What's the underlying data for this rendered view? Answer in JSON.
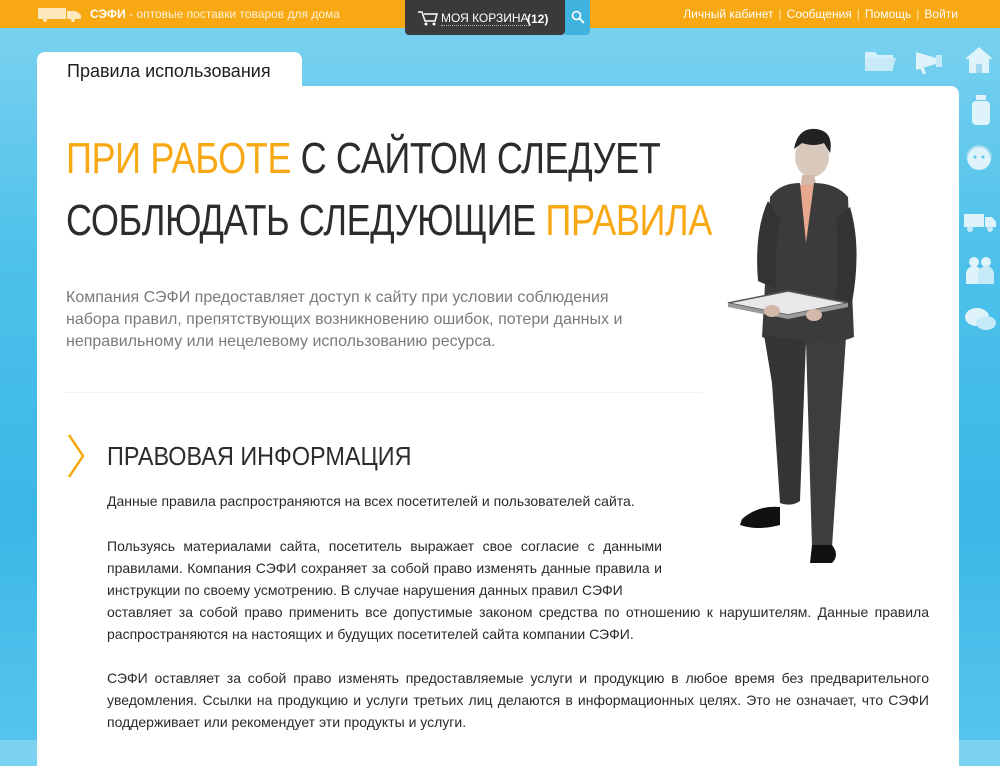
{
  "header": {
    "brand_name": "СЭФИ",
    "brand_tagline": " - оптовые поставки товаров для дома",
    "cart_label": "МОЯ КОРЗИНА",
    "cart_count": "(12)",
    "links": [
      "Личный кабинет",
      "Сообщения",
      "Помощь",
      "Войти"
    ],
    "separator": "|"
  },
  "tab": {
    "label": "Правила использования"
  },
  "headline": {
    "line1_accent": "ПРИ РАБОТЕ",
    "line1_rest": " С САЙТОМ СЛЕДУЕТ",
    "line2_main": "СОБЛЮДАТЬ СЛЕДУЮЩИЕ ",
    "line2_accent": "ПРАВИЛА"
  },
  "intro": "Компания СЭФИ предоставляет доступ к сайту при условии соблюдения набора правил, препятствующих возникновению ошибок, потери данных и неправильному или нецелевому использованию ресурса.",
  "section": {
    "title": "ПРАВОВАЯ ИНФОРМАЦИЯ",
    "p1": "Данные правила распространяются на всех посетителей и пользователей сайта.",
    "p2a": "Пользуясь материалами сайта, посетитель выражает свое согласие с данными правилами. Компания СЭФИ сохраняет за собой право изменять данные правила и инструкции по своему усмотрению. В случае нарушения данных правил СЭФИ",
    "p2b": "оставляет за собой право применить все допустимые законом средства по отношению к нарушителям. Данные правила распространяются на настоящих и будущих посетителей сайта компании СЭФИ.",
    "p3": "СЭФИ оставляет за собой право изменять предоставляемые услуги и продукцию в любое время без предварительного уведомления. Ссылки на продукцию и услуги третьих лиц делаются в информационных целях. Это не означает, что СЭФИ поддерживает или рекомендует эти продукты и услуги."
  },
  "colors": {
    "accent": "#f8a813",
    "background": "#3bb7e6",
    "text": "#2c2c2c",
    "muted": "#7a7a7a"
  },
  "icons": [
    "truck-logo-icon",
    "cart-icon",
    "search-icon",
    "folder-icon",
    "megaphone-icon",
    "home-icon",
    "bottle-icon",
    "support-icon",
    "truck-icon",
    "people-icon",
    "chat-icon",
    "chevron-right-icon"
  ]
}
